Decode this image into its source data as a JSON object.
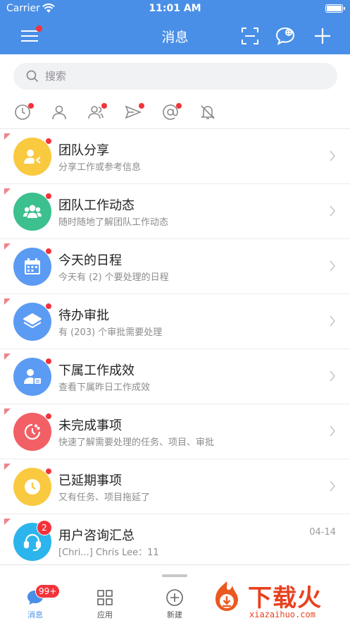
{
  "status_bar": {
    "carrier": "Carrier",
    "time": "11:01 AM"
  },
  "nav": {
    "title": "消息"
  },
  "search": {
    "placeholder": "搜索"
  },
  "messages": [
    {
      "title": "团队分享",
      "subtitle": "分享工作或参考信息",
      "avatar_color": "#f9c940",
      "icon": "share-user-icon"
    },
    {
      "title": "团队工作动态",
      "subtitle": "随时随地了解团队工作动态",
      "avatar_color": "#3bc08e",
      "icon": "team-icon"
    },
    {
      "title": "今天的日程",
      "subtitle": "今天有 (2) 个要处理的日程",
      "avatar_color": "#5b9bf3",
      "icon": "calendar-icon"
    },
    {
      "title": "待办审批",
      "subtitle": "有 (203) 个审批需要处理",
      "avatar_color": "#5b9bf3",
      "icon": "layers-icon"
    },
    {
      "title": "下属工作成效",
      "subtitle": "查看下属昨日工作成效",
      "avatar_color": "#5b9bf3",
      "icon": "user-report-icon"
    },
    {
      "title": "未完成事项",
      "subtitle": "快速了解需要处理的任务、项目、审批",
      "avatar_color": "#f25f65",
      "icon": "clock-icon"
    },
    {
      "title": "已延期事项",
      "subtitle": "又有任务、项目拖延了",
      "avatar_color": "#f9c940",
      "icon": "clock-icon"
    },
    {
      "title": "用户咨询汇总",
      "subtitle": "[Chri...] Chris Lee：11",
      "avatar_color": "#2bb5ec",
      "icon": "headset-icon",
      "badge": "2",
      "date": "04-14"
    }
  ],
  "tabs": [
    {
      "label": "消息",
      "badge": "99+",
      "icon": "chat-icon",
      "active": true
    },
    {
      "label": "应用",
      "icon": "grid-icon",
      "active": false
    },
    {
      "label": "新建",
      "icon": "plus-circle-icon",
      "active": false
    }
  ],
  "watermark": {
    "text": "下载火",
    "sub": "xiazaihuo.com"
  },
  "colors": {
    "primary": "#4a8fe7",
    "badge_red": "#f3333b"
  }
}
